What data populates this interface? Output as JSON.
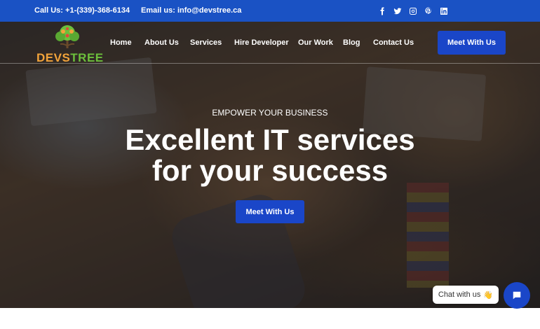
{
  "topbar": {
    "call_label": "Call Us:",
    "phone": "+1-(339)-368-6134",
    "email_label": "Email us:",
    "email": "info@devstree.ca",
    "socials": [
      "facebook-icon",
      "twitter-icon",
      "instagram-icon",
      "pinterest-icon",
      "linkedin-icon"
    ],
    "background": "#1a52c4"
  },
  "logo": {
    "dev": "DEVS",
    "tree": "TREE"
  },
  "nav": {
    "items": [
      "Home",
      "About Us",
      "Services",
      "Hire Developer",
      "Our Work",
      "Blog",
      "Contact Us"
    ]
  },
  "header": {
    "cta": "Meet With Us"
  },
  "hero": {
    "kicker": "EMPOWER YOUR BUSINESS",
    "headline_line1": "Excellent IT services",
    "headline_line2": "for your success",
    "cta": "Meet With Us"
  },
  "chat": {
    "label": "Chat with us",
    "emoji": "👋"
  },
  "colors": {
    "accent": "#1a46c8",
    "logo_orange": "#f2a33a",
    "logo_green": "#6cbf3c"
  }
}
